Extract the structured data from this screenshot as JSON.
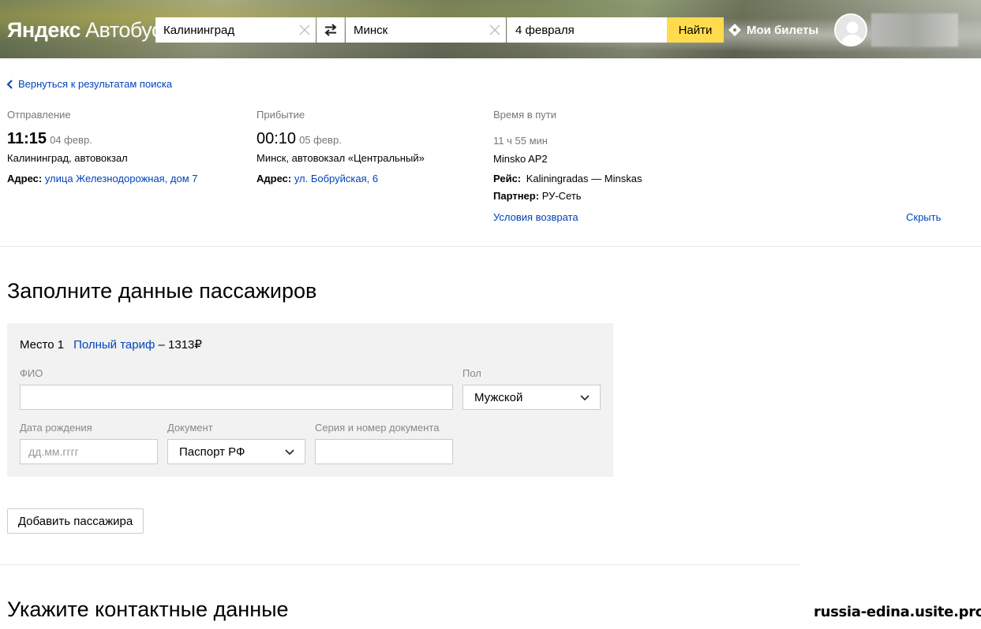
{
  "header": {
    "logo_brand": "Яндекс",
    "logo_service": "Автобусы",
    "from_value": "Калининград",
    "to_value": "Минск",
    "date_value": "4 февраля",
    "find_label": "Найти",
    "my_tickets_label": "Мои билеты"
  },
  "back_link": "Вернуться к результатам поиска",
  "departure": {
    "label": "Отправление",
    "time": "11:15",
    "date": "04 февр.",
    "station": "Калининград, автовокзал",
    "address_key": "Адрес:",
    "address_value": "улица Железнодорожная, дом 7"
  },
  "arrival": {
    "label": "Прибытие",
    "time": "00:10",
    "date": "05 февр.",
    "station": "Минск, автовокзал «Центральный»",
    "address_key": "Адрес:",
    "address_value": "ул. Бобруйская, 6"
  },
  "travel": {
    "label": "Время в пути",
    "duration": "11 ч 55 мин",
    "carrier": "Minsko AP2",
    "route_key": "Рейс:",
    "route_value": "Kaliningradas — Minskas",
    "partner_key": "Партнер:",
    "partner_value": "РУ-Сеть",
    "refund_link": "Условия возврата",
    "hide_link": "Скрыть"
  },
  "passengers": {
    "title": "Заполните данные пассажиров",
    "seat_label": "Место 1",
    "tariff_label": "Полный тариф",
    "price": " – 1313₽",
    "fio_label": "ФИО",
    "fio_value": "",
    "gender_label": "Пол",
    "gender_value": "Мужской",
    "birth_label": "Дата рождения",
    "birth_placeholder": "дд.мм.гггг",
    "doc_label": "Документ",
    "doc_value": "Паспорт РФ",
    "doc_number_label": "Серия и номер документа",
    "doc_number_value": "",
    "add_passenger": "Добавить пассажира"
  },
  "contacts": {
    "title": "Укажите контактные данные"
  },
  "watermark": "russia-edina.usite.pro",
  "colors": {
    "accent_yellow": "#ffdb4d",
    "link_blue": "#0044bb",
    "card_gray": "#f2f2f2"
  }
}
